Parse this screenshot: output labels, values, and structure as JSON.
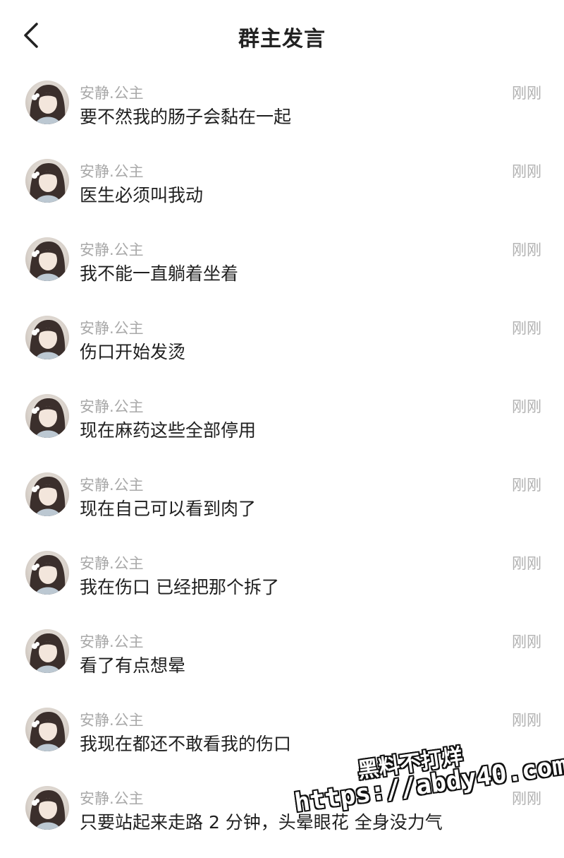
{
  "header": {
    "title": "群主发言",
    "back_icon": "chevron-left-icon"
  },
  "messages": [
    {
      "sender": "安静.公主",
      "time": "刚刚",
      "text": "要不然我的肠子会黏在一起"
    },
    {
      "sender": "安静.公主",
      "time": "刚刚",
      "text": "医生必须叫我动"
    },
    {
      "sender": "安静.公主",
      "time": "刚刚",
      "text": "我不能一直躺着坐着"
    },
    {
      "sender": "安静.公主",
      "time": "刚刚",
      "text": "伤口开始发烫"
    },
    {
      "sender": "安静.公主",
      "time": "刚刚",
      "text": "现在麻药这些全部停用"
    },
    {
      "sender": "安静.公主",
      "time": "刚刚",
      "text": "现在自己可以看到肉了"
    },
    {
      "sender": "安静.公主",
      "time": "刚刚",
      "text": "我在伤口 已经把那个拆了"
    },
    {
      "sender": "安静.公主",
      "time": "刚刚",
      "text": "看了有点想晕"
    },
    {
      "sender": "安静.公主",
      "time": "刚刚",
      "text": "我现在都还不敢看我的伤口"
    },
    {
      "sender": "安静.公主",
      "time": "刚刚",
      "text": "只要站起来走路 2 分钟，头晕眼花 全身没力气"
    }
  ],
  "watermark": {
    "line1": "黑料不打烊",
    "line2": "https://abdy40.com"
  },
  "colors": {
    "sender": "#a9a9a9",
    "time": "#b0b0b0",
    "text": "#1f1f1f",
    "background": "#ffffff"
  }
}
